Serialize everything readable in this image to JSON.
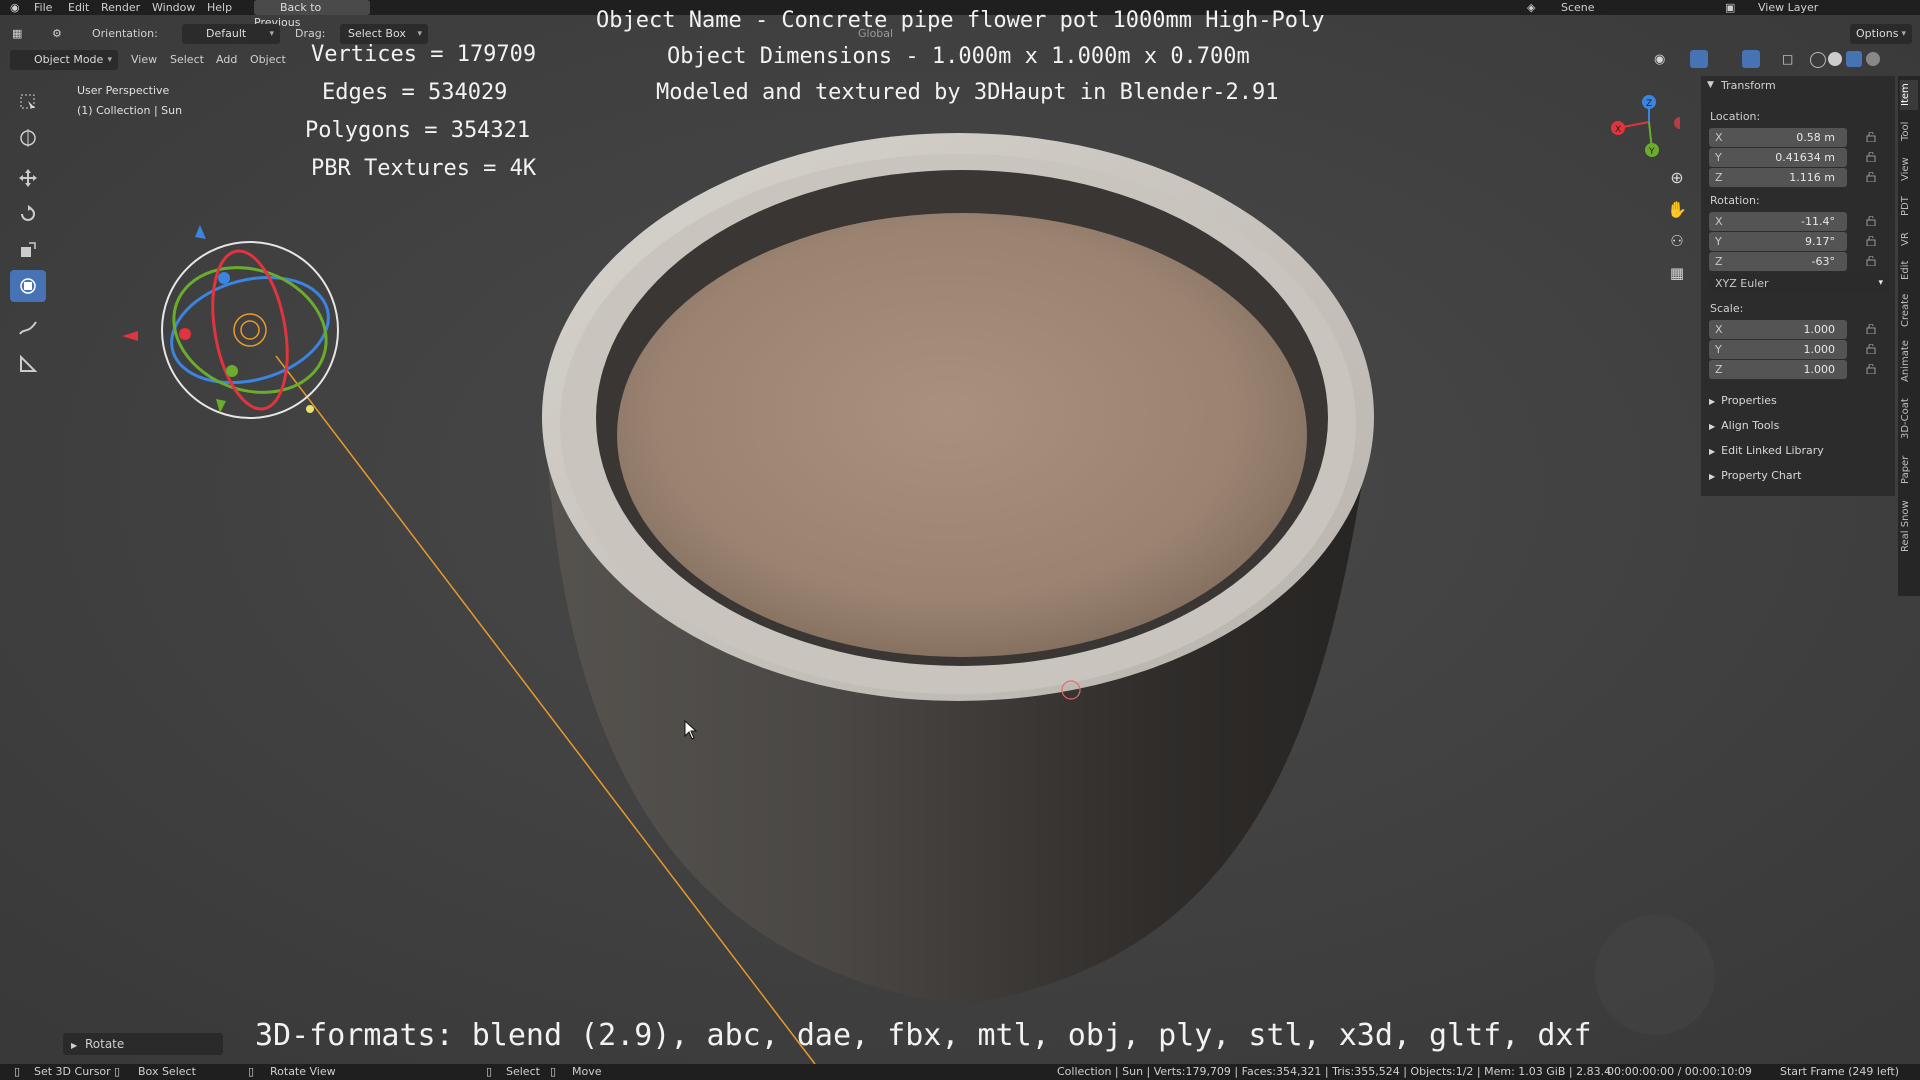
{
  "menu": {
    "items": [
      "File",
      "Edit",
      "Render",
      "Window",
      "Help"
    ],
    "back_button": "Back to Previous",
    "scene_label": "Scene",
    "view_layer_label": "View Layer"
  },
  "header": {
    "orientation_label": "Orientation:",
    "orientation_value": "Default",
    "drag_label": "Drag:",
    "drag_value": "Select Box",
    "transform_value": "Global",
    "options_label": "Options"
  },
  "header2": {
    "mode": "Object Mode",
    "items": [
      "View",
      "Select",
      "Add",
      "Object"
    ]
  },
  "viewport": {
    "perspective": "User Perspective",
    "collection": "(1) Collection | Sun"
  },
  "overlay": {
    "vertices": "Vertices = 179709",
    "edges": "Edges = 534029",
    "polygons": "Polygons = 354321",
    "textures": "PBR Textures = 4K",
    "object_name": "Object Name - Concrete pipe flower pot 1000mm High-Poly",
    "dimensions": "Object Dimensions -  1.000m x 1.000m x 0.700m",
    "credit": "Modeled and textured by 3DHaupt in Blender-2.91",
    "formats": "3D-formats: blend (2.9), abc, dae, fbx, mtl, obj, ply, stl, x3d, gltf, dxf"
  },
  "npanel": {
    "title": "Transform",
    "location_label": "Location:",
    "location": [
      {
        "axis": "X",
        "value": "0.58 m"
      },
      {
        "axis": "Y",
        "value": "0.41634 m"
      },
      {
        "axis": "Z",
        "value": "1.116 m"
      }
    ],
    "rotation_label": "Rotation:",
    "rotation": [
      {
        "axis": "X",
        "value": "-11.4°"
      },
      {
        "axis": "Y",
        "value": "9.17°"
      },
      {
        "axis": "Z",
        "value": "-63°"
      }
    ],
    "rotation_mode": "XYZ Euler",
    "scale_label": "Scale:",
    "scale": [
      {
        "axis": "X",
        "value": "1.000"
      },
      {
        "axis": "Y",
        "value": "1.000"
      },
      {
        "axis": "Z",
        "value": "1.000"
      }
    ],
    "sections": [
      "Properties",
      "Align Tools",
      "Edit Linked Library",
      "Property Chart"
    ]
  },
  "side_tabs": [
    "Item",
    "Tool",
    "View",
    "PDT",
    "VR",
    "Edit",
    "Create",
    "Animate",
    "3D-Coat",
    "Paper",
    "Real Snow"
  ],
  "gizmo_axes": {
    "x": "X",
    "y": "Y",
    "z": "Z"
  },
  "operator_panel": "Rotate",
  "status": {
    "set_cursor": "Set 3D Cursor",
    "box_select": "Box Select",
    "rotate_view": "Rotate View",
    "select": "Select",
    "move": "Move",
    "stats": "Collection | Sun | Verts:179,709 | Faces:354,321 | Tris:355,524 | Objects:1/2 | Mem: 1.03 GiB | 2.83.4",
    "time": "00:00:00:00 / 00:00:10:09",
    "frame": "Start Frame (249 left)"
  },
  "colors": {
    "accent": "#4772b3",
    "axis_x": "#e0343f",
    "axis_y": "#6aac2c",
    "axis_z": "#3b84df",
    "light_line": "#e89a2a"
  }
}
